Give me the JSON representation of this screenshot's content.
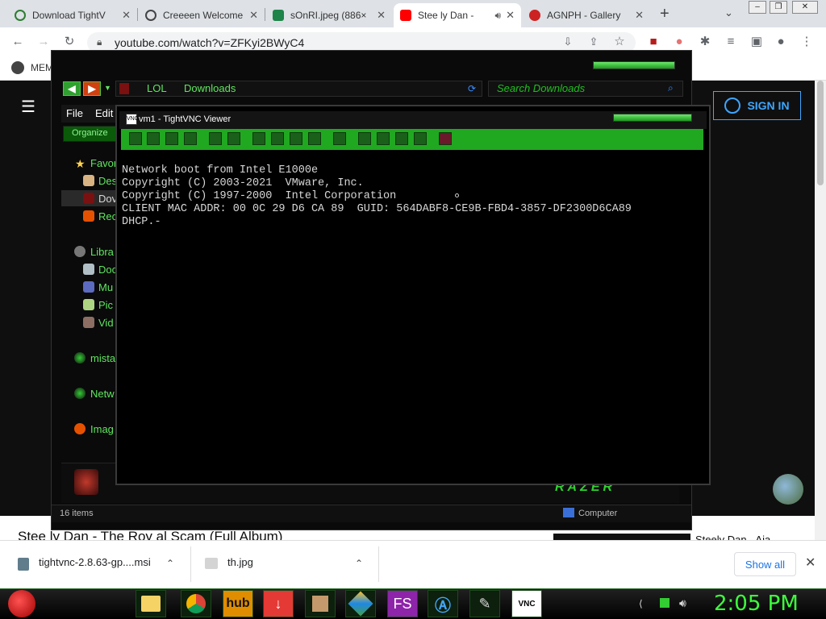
{
  "tabs": [
    {
      "title": "Download TightV",
      "color": "#2e7d32"
    },
    {
      "title": "Creeeen Welcome",
      "color": "#444444"
    },
    {
      "title": "sOnRI.jpeg (886×",
      "color": "#1e8449"
    },
    {
      "title": "Stee ly Dan -",
      "color": "#ff0000"
    },
    {
      "title": "AGNPH - Gallery",
      "color": "#cc2222"
    }
  ],
  "browser": {
    "url": "youtube.com/watch?v=ZFKyi2BWyC4",
    "bookmark_label": "MEM",
    "signin_label": "SIGN IN"
  },
  "explorer": {
    "path_parts": [
      "LOL",
      "Downloads"
    ],
    "search_placeholder": "Search Downloads",
    "menu": [
      "File",
      "Edit"
    ],
    "organize_label": "Organize",
    "sidebar": [
      "Favor",
      "Des",
      "Dov",
      "Rec",
      "Libra",
      "Doc",
      "Mu",
      "Pic",
      "Vid",
      "mista",
      "Netw",
      "Imag"
    ],
    "status_items": "16 items",
    "status_location": "Computer"
  },
  "vnc": {
    "title": "vm1 - TightVNC Viewer",
    "console_lines": [
      "Network boot from Intel E1000e",
      "Copyright (C) 2003-2021  VMware, Inc.",
      "Copyright (C) 1997-2000  Intel Corporation",
      "",
      "CLIENT MAC ADDR: 00 0C 29 D6 CA 89  GUID: 564DABF8-CE9B-FBD4-3857-DF2300D6CA89",
      "DHCP.-"
    ]
  },
  "youtube": {
    "video_title": "Stee ly Dan - The Roy al Scam (Full Album)",
    "side_title": "Steely Dan - Aja"
  },
  "downloads": {
    "items": [
      "tightvnc-2.8.63-gp....msi",
      "th.jpg"
    ],
    "show_all": "Show all"
  },
  "taskbar": {
    "clock": "2:05 PM",
    "apps": [
      "folder",
      "chrome",
      "hub",
      "download",
      "box",
      "kite",
      "FS",
      "A",
      "brush",
      "VNC"
    ]
  },
  "colors": {
    "accent_green": "#3cff3c",
    "youtube_blue": "#3ea6ff"
  }
}
